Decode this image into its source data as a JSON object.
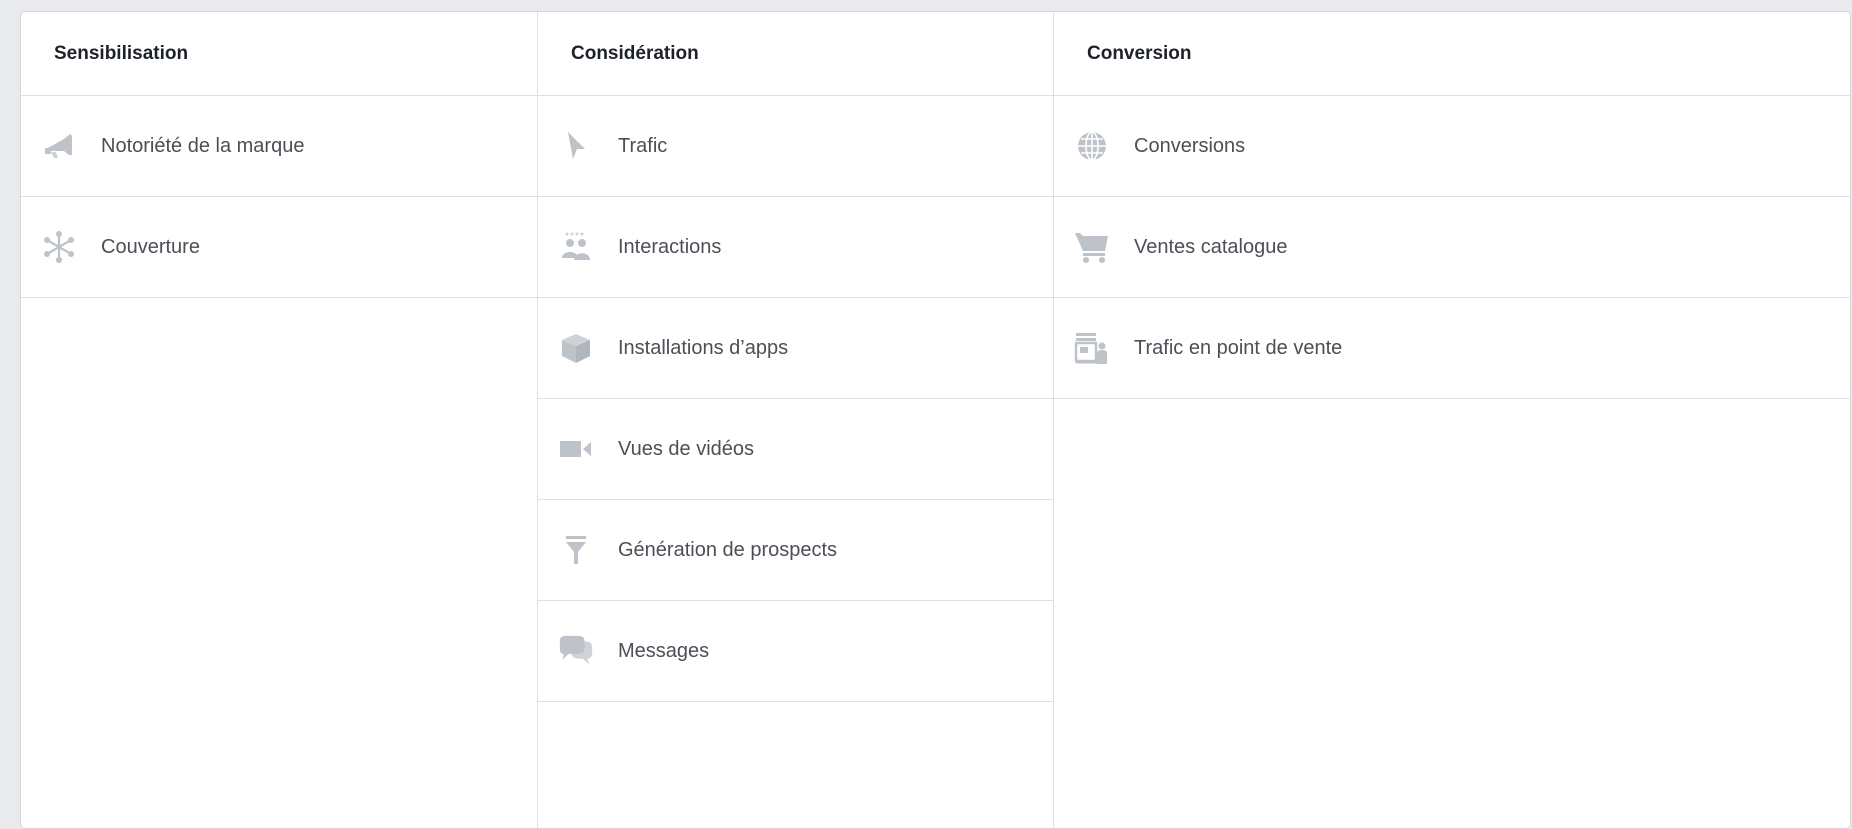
{
  "columns": [
    {
      "header": "Sensibilisation",
      "items": [
        {
          "label": "Notoriété de la marque",
          "icon": "megaphone-icon"
        },
        {
          "label": "Couverture",
          "icon": "reach-asterisk-icon"
        }
      ]
    },
    {
      "header": "Considération",
      "items": [
        {
          "label": "Trafic",
          "icon": "cursor-icon"
        },
        {
          "label": "Interactions",
          "icon": "people-icon"
        },
        {
          "label": "Installations d’apps",
          "icon": "box-icon"
        },
        {
          "label": "Vues de vidéos",
          "icon": "video-camera-icon"
        },
        {
          "label": "Génération de prospects",
          "icon": "funnel-icon"
        },
        {
          "label": "Messages",
          "icon": "chat-bubbles-icon"
        }
      ]
    },
    {
      "header": "Conversion",
      "items": [
        {
          "label": "Conversions",
          "icon": "globe-icon"
        },
        {
          "label": "Ventes catalogue",
          "icon": "shopping-cart-icon"
        },
        {
          "label": "Trafic en point de vente",
          "icon": "storefront-icon"
        }
      ]
    }
  ],
  "colors": {
    "icon": "#bec3c9",
    "text": "#4b4f56",
    "header": "#1d2129",
    "border": "#dddfe2"
  }
}
